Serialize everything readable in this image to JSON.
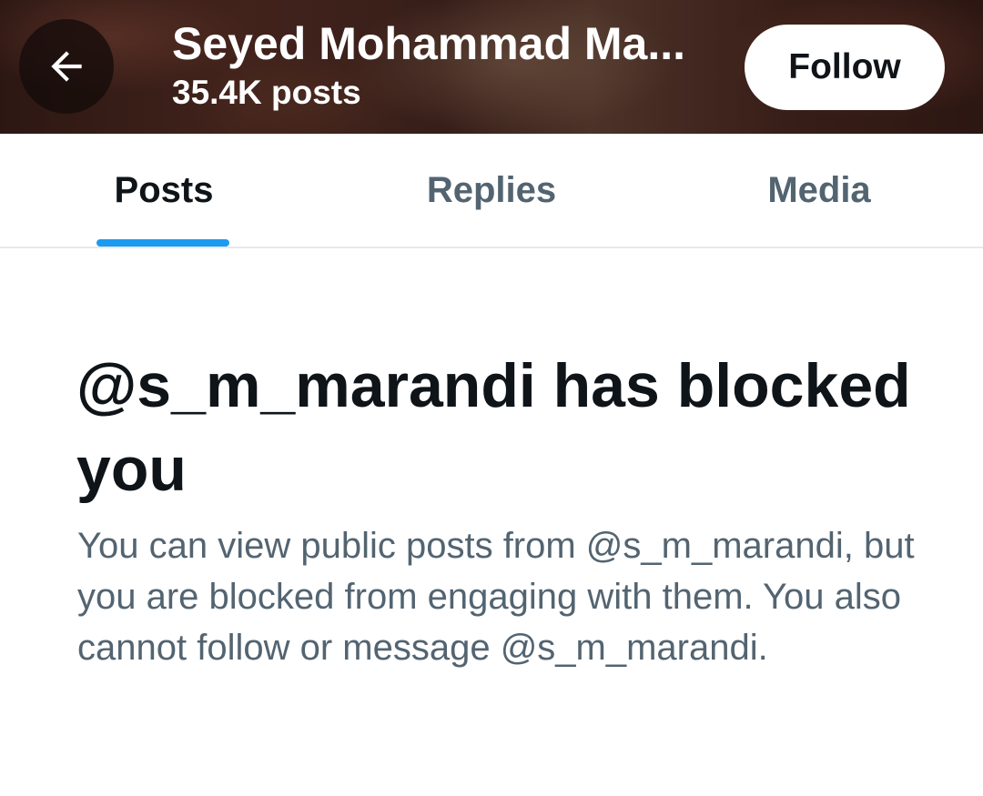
{
  "header": {
    "title": "Seyed Mohammad Ma...",
    "post_count": "35.4K posts",
    "follow_label": "Follow",
    "back_icon": "arrow-left-icon"
  },
  "tabs": [
    {
      "label": "Posts",
      "active": true
    },
    {
      "label": "Replies",
      "active": false
    },
    {
      "label": "Media",
      "active": false
    }
  ],
  "blocked": {
    "title": "@s_m_marandi has blocked you",
    "description": "You can view public posts from @s_m_marandi, but you are blocked from engaging with them. You also cannot follow or message @s_m_marandi."
  },
  "colors": {
    "accent": "#1d9bf0",
    "primary_text": "#0f1419",
    "secondary_text": "#536471"
  }
}
